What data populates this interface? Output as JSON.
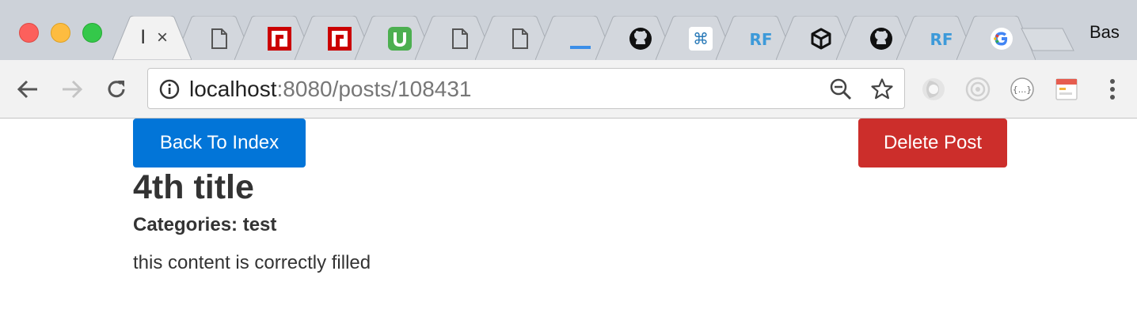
{
  "browser": {
    "active_tab": {
      "title": "l",
      "close_glyph": "×"
    },
    "tabs": [
      {
        "icon": "page-icon"
      },
      {
        "icon": "npm-icon"
      },
      {
        "icon": "npm-icon"
      },
      {
        "icon": "u-icon"
      },
      {
        "icon": "page-icon"
      },
      {
        "icon": "page-icon"
      },
      {
        "icon": "underscore-icon"
      },
      {
        "icon": "github-icon"
      },
      {
        "icon": "command-icon"
      },
      {
        "icon": "rf-icon"
      },
      {
        "icon": "codepen-icon"
      },
      {
        "icon": "github-icon"
      },
      {
        "icon": "rf-icon"
      },
      {
        "icon": "google-icon"
      }
    ],
    "user_name": "Bas",
    "address": {
      "host": "localhost",
      "rest": ":8080/posts/108431"
    },
    "extensions": [
      "dark-orb-icon",
      "circle-target-icon",
      "json-icon",
      "calendar-icon"
    ]
  },
  "page": {
    "back_label": "Back To Index",
    "delete_label": "Delete Post",
    "title": "4th title",
    "categories": "Categories: test",
    "content": "this content is correctly filled"
  },
  "colors": {
    "primary": "#0275d8",
    "danger": "#cc2e2b",
    "text": "#333333",
    "tabstrip": "#cdd2d9",
    "toolbar": "#f2f2f2"
  }
}
